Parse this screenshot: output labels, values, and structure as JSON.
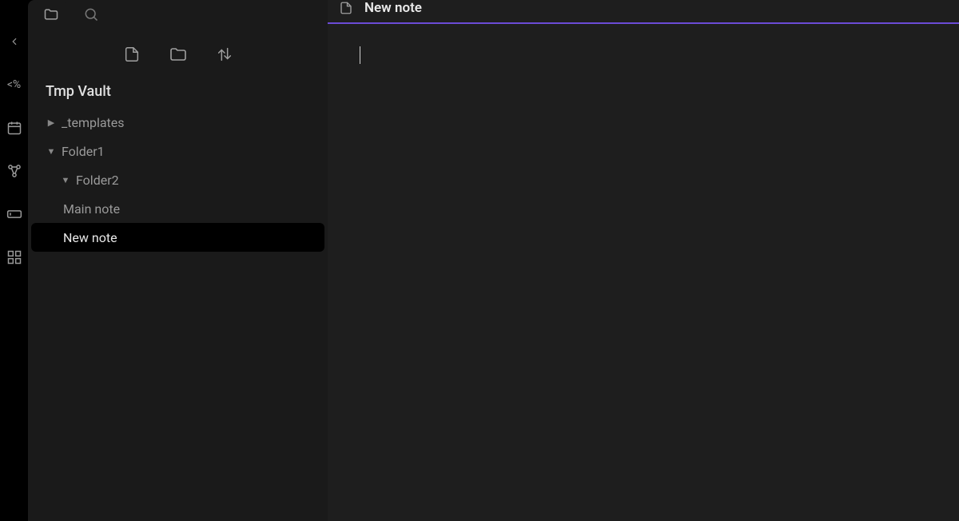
{
  "ribbon": {
    "items": [
      {
        "name": "collapse-icon"
      },
      {
        "name": "templater-icon"
      },
      {
        "name": "daily-note-icon"
      },
      {
        "name": "graph-view-icon"
      },
      {
        "name": "command-palette-icon"
      },
      {
        "name": "canvas-icon"
      }
    ]
  },
  "sidebar": {
    "tabs": {
      "file_explorer": "files",
      "search": "search"
    },
    "toolbar": {
      "new_note": "new-note",
      "new_folder": "new-folder",
      "sort": "sort"
    },
    "vault_name": "Tmp Vault",
    "tree": [
      {
        "type": "folder",
        "label": "_templates",
        "expanded": false,
        "level": 0
      },
      {
        "type": "folder",
        "label": "Folder1",
        "expanded": true,
        "level": 0
      },
      {
        "type": "folder",
        "label": "Folder2",
        "expanded": true,
        "level": 1
      },
      {
        "type": "file",
        "label": "Main note",
        "active": false,
        "level": 1
      },
      {
        "type": "file",
        "label": "New note",
        "active": true,
        "level": 0
      }
    ]
  },
  "main": {
    "tab_title": "New note"
  }
}
